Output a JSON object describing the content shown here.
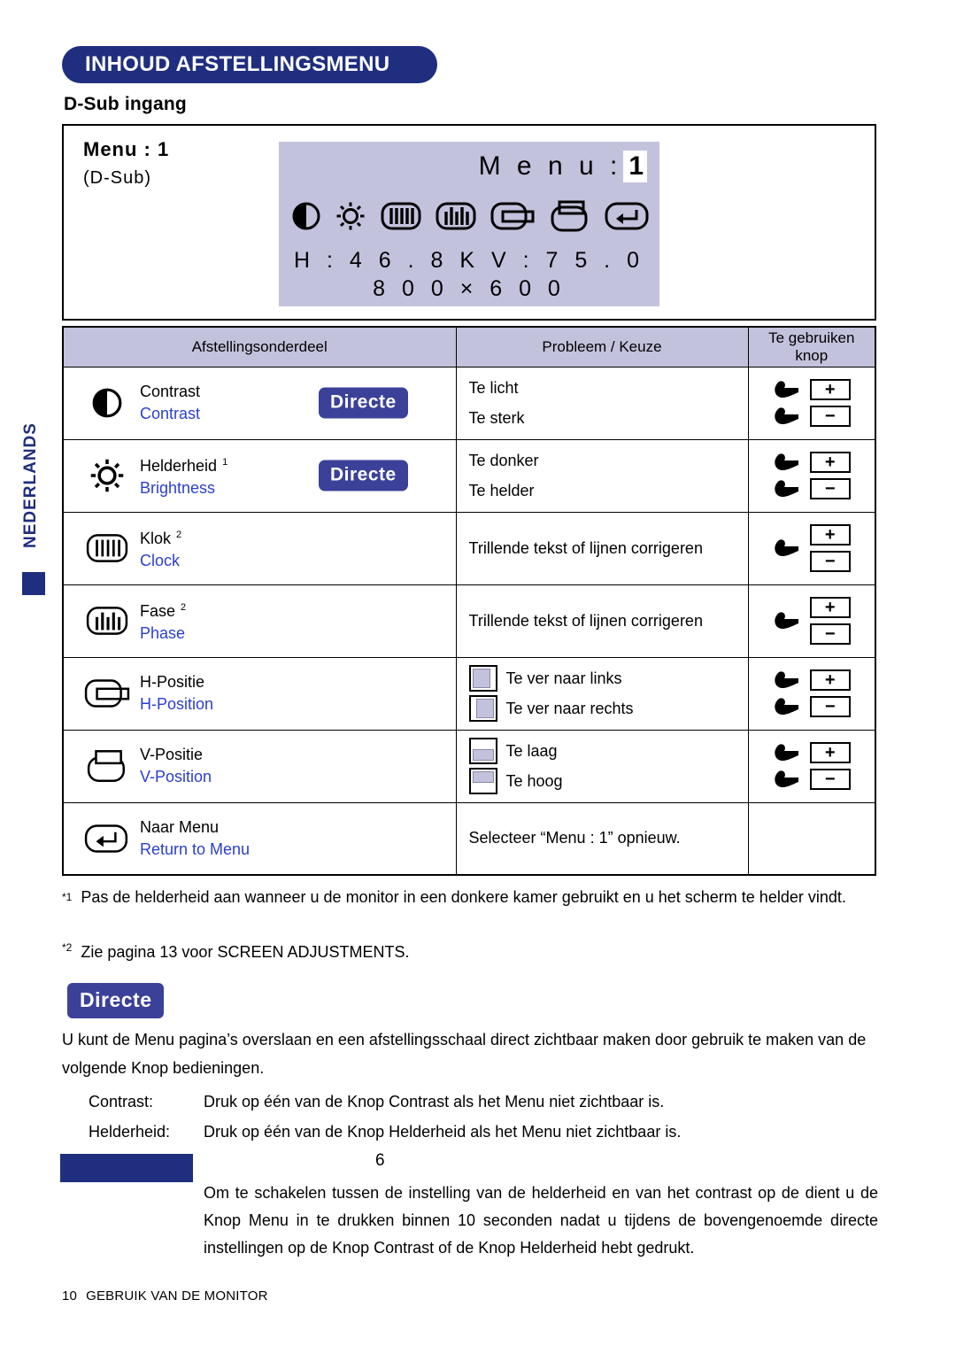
{
  "page": {
    "title": "INHOUD AFSTELLINGSMENU",
    "subtitle": "D-Sub ingang",
    "side_tab": "NEDERLANDS",
    "footer_page_number": "10",
    "footer_section": "GEBRUIK VAN DE MONITOR",
    "stray_number": "6"
  },
  "colors": {
    "brand_blue": "#1f2e7f",
    "badge_blue": "#3b4199",
    "link_blue": "#2a3fcf",
    "lavender": "#c3c2dd"
  },
  "osd": {
    "menu_label": "Menu : 1",
    "input_label": "(D-Sub)",
    "screen": {
      "menu_prefix": "M e n u :",
      "menu_value": "1",
      "frequency": "H : 4 6 . 8 K    V : 7 5 . 0",
      "resolution": "8 0 0  ×  6 0 0",
      "icons": [
        "contrast-icon",
        "brightness-icon",
        "clock-icon",
        "phase-icon",
        "h-position-icon",
        "v-position-icon",
        "return-icon"
      ]
    }
  },
  "table": {
    "headers": [
      "Afstellingsonderdeel",
      "Probleem / Keuze",
      "Te gebruiken knop"
    ],
    "rows": [
      {
        "icon": "contrast-icon",
        "nl": "Contrast",
        "en": "Contrast",
        "footnote": "",
        "badge": "Directe",
        "problems": [
          {
            "text": "Te licht",
            "button": "+"
          },
          {
            "text": "Te sterk",
            "button": "−"
          }
        ]
      },
      {
        "icon": "brightness-icon",
        "nl": "Helderheid",
        "en": "Brightness",
        "footnote": "1",
        "badge": "Directe",
        "problems": [
          {
            "text": "Te donker",
            "button": "+"
          },
          {
            "text": "Te helder",
            "button": "−"
          }
        ]
      },
      {
        "icon": "clock-icon",
        "nl": "Klok",
        "en": "Clock",
        "footnote": "2",
        "badge": "",
        "problems": [
          {
            "text": "Trillende tekst of lijnen corrigeren",
            "button": "+−"
          }
        ]
      },
      {
        "icon": "phase-icon",
        "nl": "Fase",
        "en": "Phase",
        "footnote": "2",
        "badge": "",
        "problems": [
          {
            "text": "Trillende tekst of lijnen corrigeren",
            "button": "+−"
          }
        ]
      },
      {
        "icon": "h-position-icon",
        "nl": "H-Positie",
        "en": "H-Position",
        "footnote": "",
        "badge": "",
        "problems": [
          {
            "text": "Te ver naar links",
            "button": "+",
            "indicator": "left"
          },
          {
            "text": "Te ver naar rechts",
            "button": "−",
            "indicator": "right"
          }
        ]
      },
      {
        "icon": "v-position-icon",
        "nl": "V-Positie",
        "en": "V-Position",
        "footnote": "",
        "badge": "",
        "problems": [
          {
            "text": "Te laag",
            "button": "+",
            "indicator": "low"
          },
          {
            "text": "Te hoog",
            "button": "−",
            "indicator": "high"
          }
        ]
      },
      {
        "icon": "return-icon",
        "nl": "Naar Menu",
        "en": "Return to Menu",
        "footnote": "",
        "badge": "",
        "problems": [
          {
            "text": "Selecteer “Menu : 1” opnieuw.",
            "button": ""
          }
        ]
      }
    ]
  },
  "footnotes": {
    "one_marker": "*1",
    "one_text": "Pas de helderheid aan wanneer u de monitor in een donkere kamer gebruikt en u het scherm te helder vindt.",
    "two_marker": "*2",
    "two_text": "Zie pagina 13 voor SCREEN ADJUSTMENTS."
  },
  "directe_section": {
    "badge": "Directe",
    "intro": "U kunt de Menu pagina’s overslaan en een afstellingsschaal direct zichtbaar maken door gebruik te maken van de volgende Knop bedieningen.",
    "items": [
      {
        "label": "Contrast:",
        "value": "Druk op één van de Knop Contrast als het Menu niet zichtbaar is."
      },
      {
        "label": "Helderheid:",
        "value": "Druk op één van de Knop Helderheid als het Menu niet zichtbaar is."
      }
    ],
    "note": "Om te schakelen tussen de instelling van de helderheid en van het contrast op de dient u de Knop Menu in te drukken binnen 10 seconden nadat u tijdens de bovengenoemde directe instellingen op de Knop Contrast of de Knop Helderheid hebt gedrukt."
  }
}
